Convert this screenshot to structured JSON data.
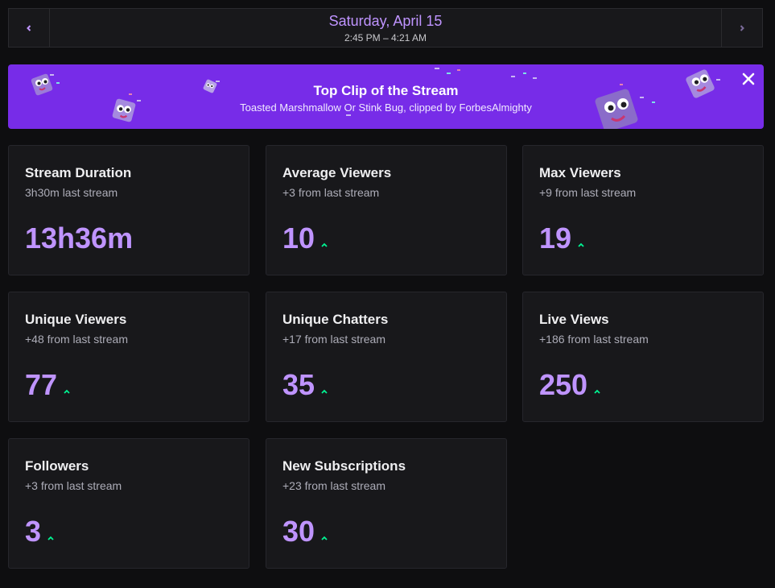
{
  "date_nav": {
    "title": "Saturday, April 15",
    "time_range": "2:45 PM – 4:21 AM"
  },
  "clip_banner": {
    "title": "Top Clip of the Stream",
    "subtitle": "Toasted Marshmallow Or Stink Bug, clipped by ForbesAlmighty"
  },
  "stats": [
    {
      "title": "Stream Duration",
      "sub": "3h30m last stream",
      "value": "13h36m",
      "trend": "none"
    },
    {
      "title": "Average Viewers",
      "sub": "+3 from last stream",
      "value": "10",
      "trend": "up"
    },
    {
      "title": "Max Viewers",
      "sub": "+9 from last stream",
      "value": "19",
      "trend": "up"
    },
    {
      "title": "Unique Viewers",
      "sub": "+48 from last stream",
      "value": "77",
      "trend": "up"
    },
    {
      "title": "Unique Chatters",
      "sub": "+17 from last stream",
      "value": "35",
      "trend": "up"
    },
    {
      "title": "Live Views",
      "sub": "+186 from last stream",
      "value": "250",
      "trend": "up"
    },
    {
      "title": "Followers",
      "sub": "+3 from last stream",
      "value": "3",
      "trend": "up"
    },
    {
      "title": "New Subscriptions",
      "sub": "+23 from last stream",
      "value": "30",
      "trend": "up"
    }
  ],
  "colors": {
    "accent": "#bf94ff",
    "banner": "#772ce8",
    "trend_up": "#00f593",
    "background": "#0e0e10",
    "card": "#18181b"
  },
  "icons": {
    "prev": "chevron-left-icon",
    "next": "chevron-right-icon",
    "close": "close-icon",
    "trend": "trend-up-icon"
  }
}
